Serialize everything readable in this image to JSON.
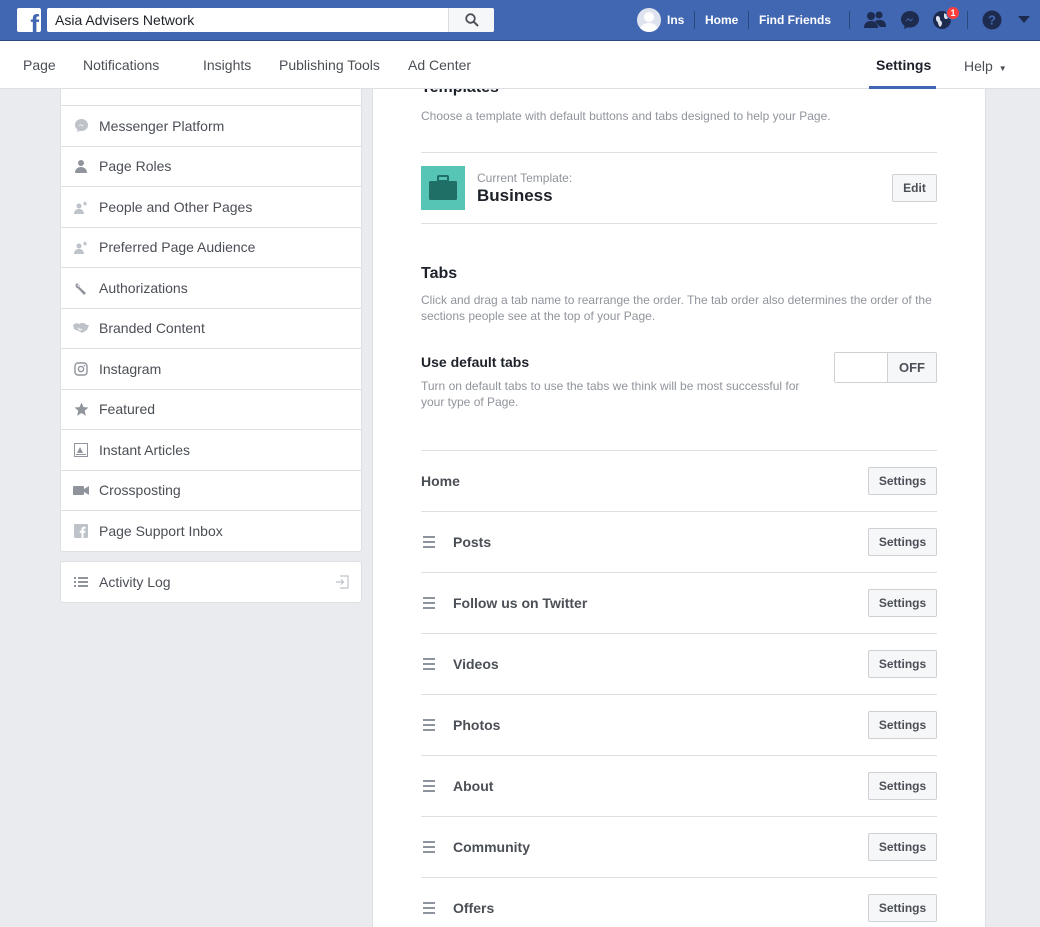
{
  "topbar": {
    "search_value": "Asia Advisers Network",
    "user_name": "Ins",
    "home_label": "Home",
    "find_friends_label": "Find Friends",
    "notification_count": "1",
    "brand_color": "#4267b2"
  },
  "subnav": {
    "items": [
      "Page",
      "Notifications",
      "Insights",
      "Publishing Tools",
      "Ad Center"
    ],
    "settings_label": "Settings",
    "help_label": "Help"
  },
  "sidebar": {
    "items": [
      {
        "label": "Messenger Platform",
        "icon": "messenger-icon"
      },
      {
        "label": "Page Roles",
        "icon": "person-icon"
      },
      {
        "label": "People and Other Pages",
        "icon": "people-star-icon"
      },
      {
        "label": "Preferred Page Audience",
        "icon": "people-star-icon"
      },
      {
        "label": "Authorizations",
        "icon": "wrench-icon"
      },
      {
        "label": "Branded Content",
        "icon": "handshake-icon"
      },
      {
        "label": "Instagram",
        "icon": "instagram-icon"
      },
      {
        "label": "Featured",
        "icon": "star-icon"
      },
      {
        "label": "Instant Articles",
        "icon": "article-icon"
      },
      {
        "label": "Crossposting",
        "icon": "video-camera-icon"
      },
      {
        "label": "Page Support Inbox",
        "icon": "facebook-square-icon"
      }
    ],
    "activity_log": "Activity Log"
  },
  "main": {
    "templates_heading": "Templates",
    "templates_desc": "Choose a template with default buttons and tabs designed to help your Page.",
    "current_template_label": "Current Template:",
    "current_template_name": "Business",
    "edit_label": "Edit",
    "tabs_heading": "Tabs",
    "tabs_desc_1": "Click and drag a tab name to rearrange the order. The tab order also determines the order of the",
    "tabs_desc_2": "sections people see at the top of your Page.",
    "default_tabs_heading": "Use default tabs",
    "default_tabs_desc_1": "Turn on default tabs to use the tabs we think will be most successful for",
    "default_tabs_desc_2": "your type of Page.",
    "toggle_label": "OFF",
    "tab_settings_label": "Settings",
    "tabs": [
      "Home",
      "Posts",
      "Follow us on Twitter",
      "Videos",
      "Photos",
      "About",
      "Community",
      "Offers"
    ]
  }
}
